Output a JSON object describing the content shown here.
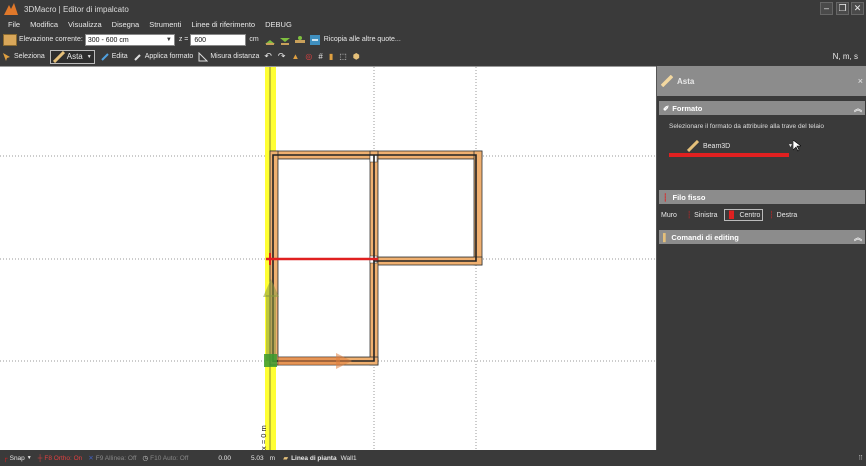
{
  "window": {
    "title": "3DMacro | Editor di impalcato",
    "minimize": "–",
    "maximize": "❐",
    "close": "✕"
  },
  "menu": [
    "File",
    "Modifica",
    "Visualizza",
    "Disegna",
    "Strumenti",
    "Linee di riferimento",
    "DEBUG"
  ],
  "toolbar1": {
    "elevation_label": "Elevazione corrente:",
    "elevation_value": "300 - 600 cm",
    "z_label": "z =",
    "z_value": "600",
    "unit": "cm",
    "copy_label": "Ricopia alle altre quote..."
  },
  "toolbar2": {
    "select_label": "Seleziona",
    "asta_label": "Asta",
    "edit_label": "Edita",
    "apply_format_label": "Applica formato",
    "measure_label": "Misura distanza",
    "units_label": "N, m, s"
  },
  "canvas": {
    "axis_label": "x = 0 m"
  },
  "right_panel": {
    "title": "Asta",
    "close": "×",
    "format_section": "Formato",
    "format_desc": "Selezionare il formato da attribuire alla trave del telaio",
    "format_value": "Beam3D",
    "filo_fisso_section": "Filo fisso",
    "muro_label": "Muro",
    "sinistra_label": "Sinistra",
    "centro_label": "Centro",
    "destra_label": "Destra",
    "editing_section": "Comandi di editing",
    "collapse_icon": "︽"
  },
  "status": {
    "snap_label": "Snap",
    "ortho_label": "F8 Ortho: On",
    "allinea_label": "F9 Allinea: Off",
    "auto_label": "F10 Auto: Off",
    "coord_x": "0.00",
    "coord_y": "5.03",
    "coord_unit": "m",
    "layer_label": "Linea di pianta",
    "layer_value": "Wall1"
  },
  "colors": {
    "accent_orange": "#e5a86a",
    "axis_yellow": "#ffff33",
    "highlight_red": "#e02020",
    "panel_header": "#8c8c8c"
  }
}
